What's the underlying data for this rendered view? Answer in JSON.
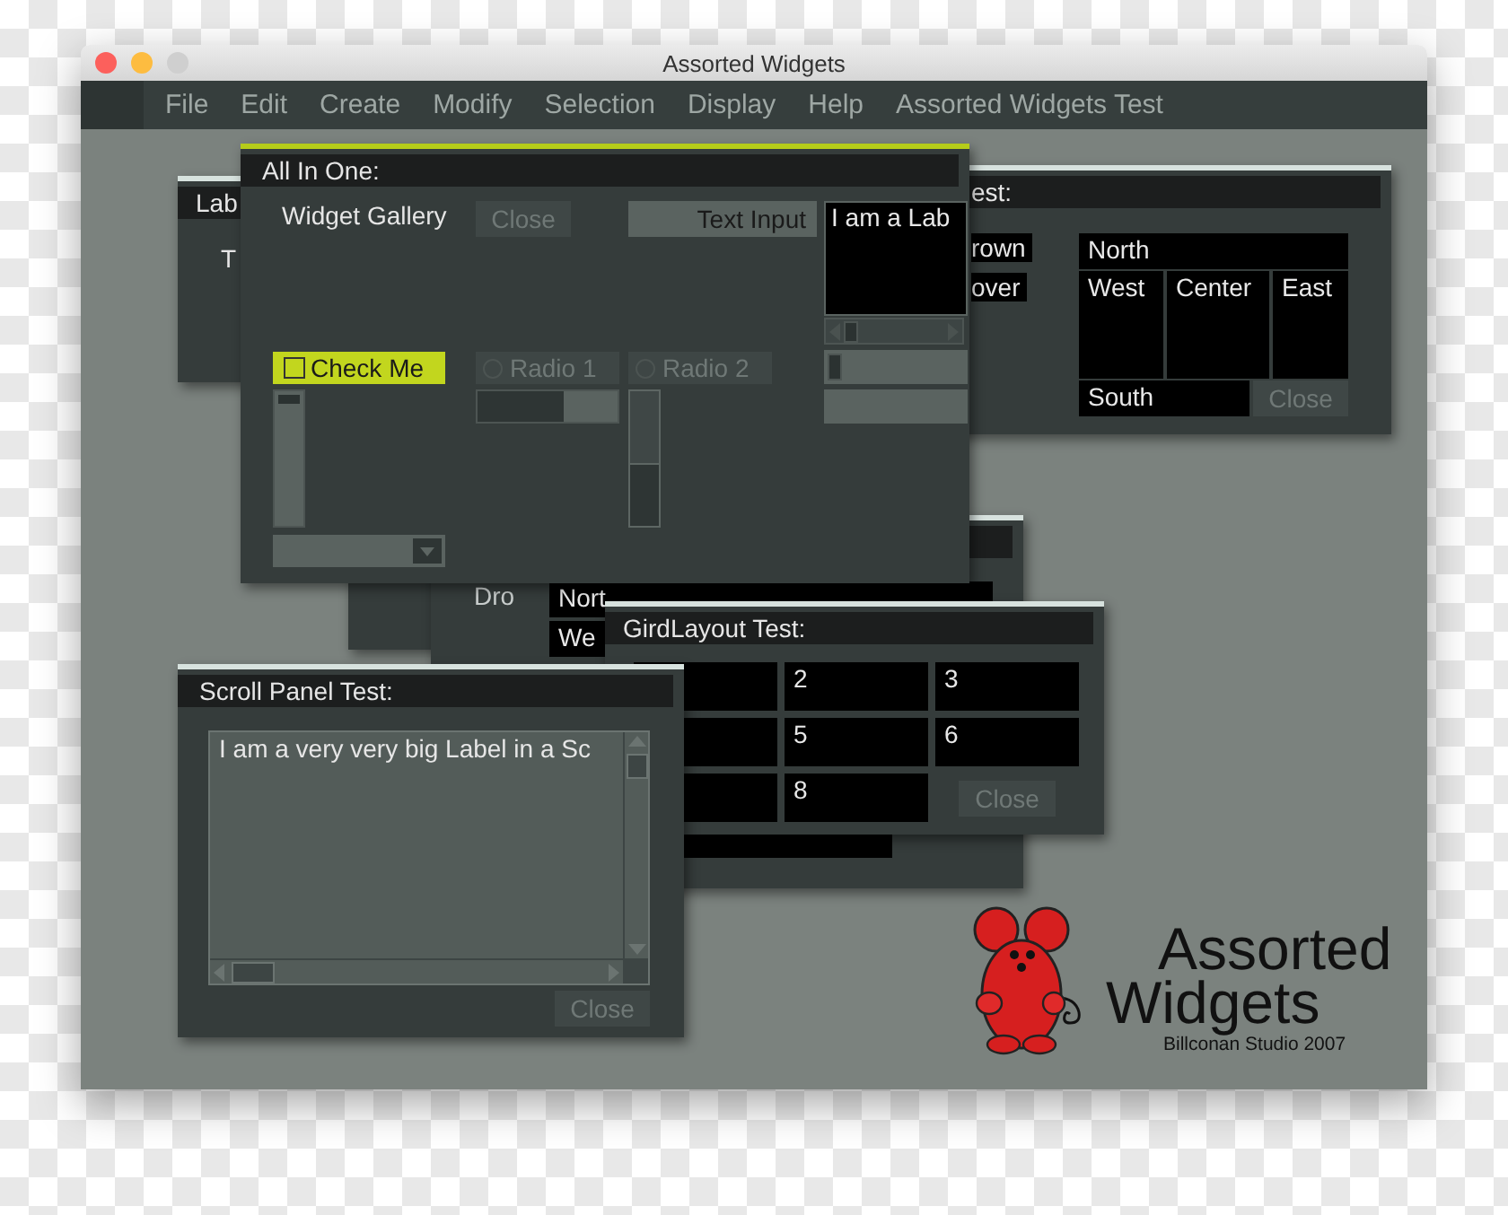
{
  "window": {
    "title": "Assorted Widgets"
  },
  "menu": [
    "File",
    "Edit",
    "Create",
    "Modify",
    "Selection",
    "Display",
    "Help",
    "Assorted Widgets Test"
  ],
  "windows": [
    {
      "kind": "gallery",
      "active": true,
      "title": "All In One:",
      "gallery_label": "Widget Gallery",
      "close": "Close",
      "text_input": "Text Input",
      "label_box": "I am a Lab",
      "checkbox": {
        "label": "Check Me",
        "checked": false,
        "focused": true
      },
      "radios": [
        {
          "label": "Radio 1",
          "selected": false
        },
        {
          "label": "Radio 2",
          "selected": false
        }
      ],
      "slider": {
        "level": 0.02
      },
      "progress": {
        "level": 0.62
      },
      "vprogress": {
        "level": 0.45
      }
    },
    {
      "kind": "label",
      "active": false,
      "title": "Lab",
      "text": "T"
    },
    {
      "kind": "border",
      "active": false,
      "title": "est:",
      "buttons": [
        "rown",
        "over"
      ],
      "north": "North",
      "west": "West",
      "center": "Center",
      "east": "East",
      "south": "South",
      "close": "Close"
    },
    {
      "kind": "dropdown",
      "active": false,
      "label": "Dro",
      "north": "Nort",
      "west": "We"
    },
    {
      "kind": "blank"
    },
    {
      "kind": "grid",
      "active": false,
      "title": "GirdLayout Test:",
      "rows": [
        [
          "2",
          "3"
        ],
        [
          "5",
          "6"
        ],
        [
          "8"
        ]
      ],
      "close": "Close"
    },
    {
      "kind": "scroll",
      "active": false,
      "title": "Scroll Panel Test:",
      "text": "I am a very very big Label in a Sc",
      "close": "Close"
    }
  ],
  "logo": {
    "line1": "Assorted",
    "line2": "Widgets",
    "credit": "Billconan Studio 2007"
  }
}
